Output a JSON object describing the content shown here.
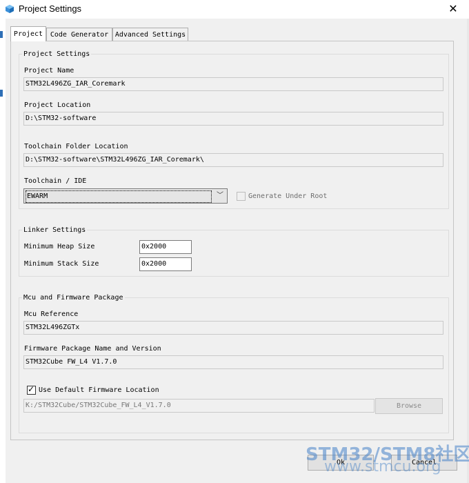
{
  "window": {
    "title": "Project Settings",
    "close_glyph": "✕",
    "icon": "stm32-cube-icon"
  },
  "tabs": [
    {
      "label": "Project",
      "active": true
    },
    {
      "label": "Code Generator",
      "active": false
    },
    {
      "label": "Advanced Settings",
      "active": false
    }
  ],
  "project_settings": {
    "group_title": "Project Settings",
    "project_name_label": "Project Name",
    "project_name_value": "STM32L496ZG_IAR_Coremark",
    "project_location_label": "Project Location",
    "project_location_value": "D:\\STM32-software",
    "toolchain_folder_label": "Toolchain Folder Location",
    "toolchain_folder_value": "D:\\STM32-software\\STM32L496ZG_IAR_Coremark\\",
    "toolchain_ide_label": "Toolchain / IDE",
    "toolchain_ide_value": "EWARM",
    "generate_under_root_label": "Generate Under Root",
    "generate_under_root_checked": false
  },
  "linker_settings": {
    "group_title": "Linker Settings",
    "min_heap_label": "Minimum Heap Size",
    "min_heap_value": "0x2000",
    "min_stack_label": "Minimum Stack Size",
    "min_stack_value": "0x2000"
  },
  "mcu_firmware": {
    "group_title": "Mcu and Firmware Package",
    "mcu_reference_label": "Mcu Reference",
    "mcu_reference_value": "STM32L496ZGTx",
    "firmware_package_label": "Firmware Package Name and Version",
    "firmware_package_value": "STM32Cube FW_L4 V1.7.0",
    "use_default_location_label": "Use Default Firmware Location",
    "use_default_location_checked": true,
    "firmware_location_value": "K:/STM32Cube/STM32Cube_FW_L4_V1.7.0",
    "browse_label": "Browse"
  },
  "footer": {
    "ok_label": "Ok",
    "cancel_label": "Cancel"
  },
  "watermark": {
    "line1": "STM32/STM8社区",
    "line2": "www.stmcu.org"
  },
  "colors": {
    "accent": "#2e6fb6",
    "watermark": "#4682c8"
  }
}
